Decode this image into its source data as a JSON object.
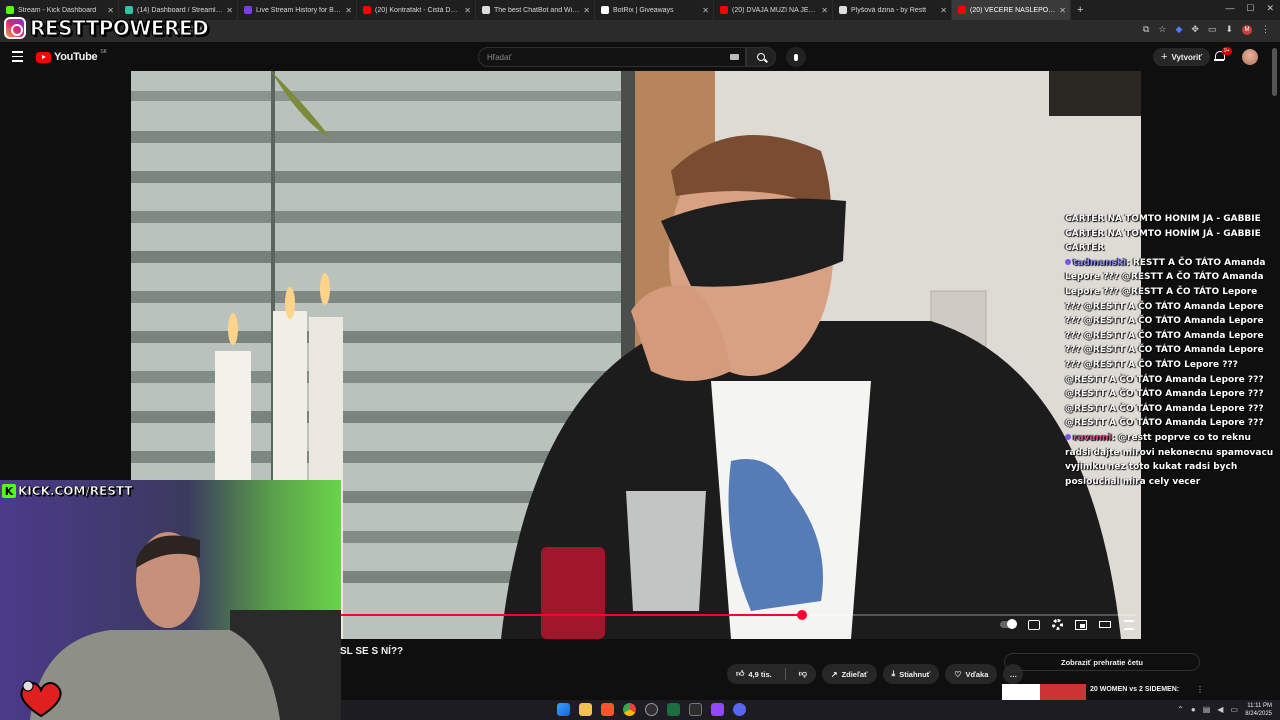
{
  "browser": {
    "tabs": [
      {
        "title": "Stream - Kick Dashboard",
        "favicon_color": "#53fc18",
        "active": false
      },
      {
        "title": "(14) Dashboard / Streamlabs",
        "favicon_color": "#31c3a2",
        "active": false
      },
      {
        "title": "Live Stream History for Blerp St",
        "favicon_color": "#7a3cf0",
        "active": false
      },
      {
        "title": "(20) Kontrafakt - Čistá Duša pre",
        "favicon_color": "#ff0000",
        "active": false
      },
      {
        "title": "The best ChatBot and Widgets",
        "favicon_color": "#dddddd",
        "active": false
      },
      {
        "title": "BotRix | Giveaways",
        "favicon_color": "#ffffff",
        "active": false
      },
      {
        "title": "(20) DVAJA MUŽI NA JEDNOM",
        "favicon_color": "#ff0000",
        "active": false
      },
      {
        "title": "Plyšová dzina - by Restt",
        "favicon_color": "#dddddd",
        "active": false
      },
      {
        "title": "(20) VEČERE NASLEPO - STV",
        "favicon_color": "#ff0000",
        "active": true
      }
    ],
    "new_tab_label": "+",
    "url_fragment": "PkC6RM"
  },
  "overlay": {
    "brand_text": "RESTTPOWERED",
    "kick_url": "KICK.COM/RESTT",
    "kick_letter": "K"
  },
  "youtube": {
    "logo_text": "YouTube",
    "region": "SK",
    "search_placeholder": "Hľadať",
    "create_label": "Vytvoriť",
    "notification_count": "9+"
  },
  "player": {
    "progress": 0.58,
    "video_title": "SL SE S NÍ??"
  },
  "actions": {
    "like_count": "4,9 tis.",
    "share_label": "Zdieľať",
    "download_label": "Stiahnuť",
    "thanks_label": "Vďaka",
    "more_label": "…"
  },
  "sidebar": {
    "show_chat_label": "Zobraziť prehratie četu",
    "rec_title": "20 WOMEN vs 2 SIDEMEN:"
  },
  "chat": {
    "lines_top": "CARTER NA TOMTO HONIM JA - GABBIE CARTER NA TOMTO HONÍM JÁ - GABBIE CARTER",
    "user1": "tadmanski",
    "msg1": ": RESTT A ČO TÁTO Amanda Lepore ??? @RESTT A ČO TÁTO Amanda Lepore ??? @RESTT A ČO TÁTO Lepore ??? @RESTT A ČO TÁTO Amanda Lepore ??? @RESTT A ČO TÁTO Amanda Lepore ??? @RESTT A ČO TÁTO Amanda Lepore ??? @RESTT A ČO TÁTO Amanda Lepore ??? @RESTT A ČO TÁTO Lepore ??? @RESTT A ČO TÁTO Amanda Lepore ??? @RESTT A ČO TÁTO Amanda Lepore ??? @RESTT A ČO TÁTO Amanda Lepore ??? @RESTT A ČO TÁTO Amanda Lepore ???",
    "user2": "ravanni",
    "msg2": ": @restt poprve co to reknu radsi dajte mirovi nekonecnu spamovacu vyjimku nez toto kukat radsi bych poslouchal mira cely vecer"
  },
  "taskbar": {
    "time": "11:11 PM",
    "date": "8/24/2025"
  },
  "colors": {
    "accent": "#ff0033",
    "kick_green": "#53fc18",
    "youtube_red": "#ff0000"
  }
}
